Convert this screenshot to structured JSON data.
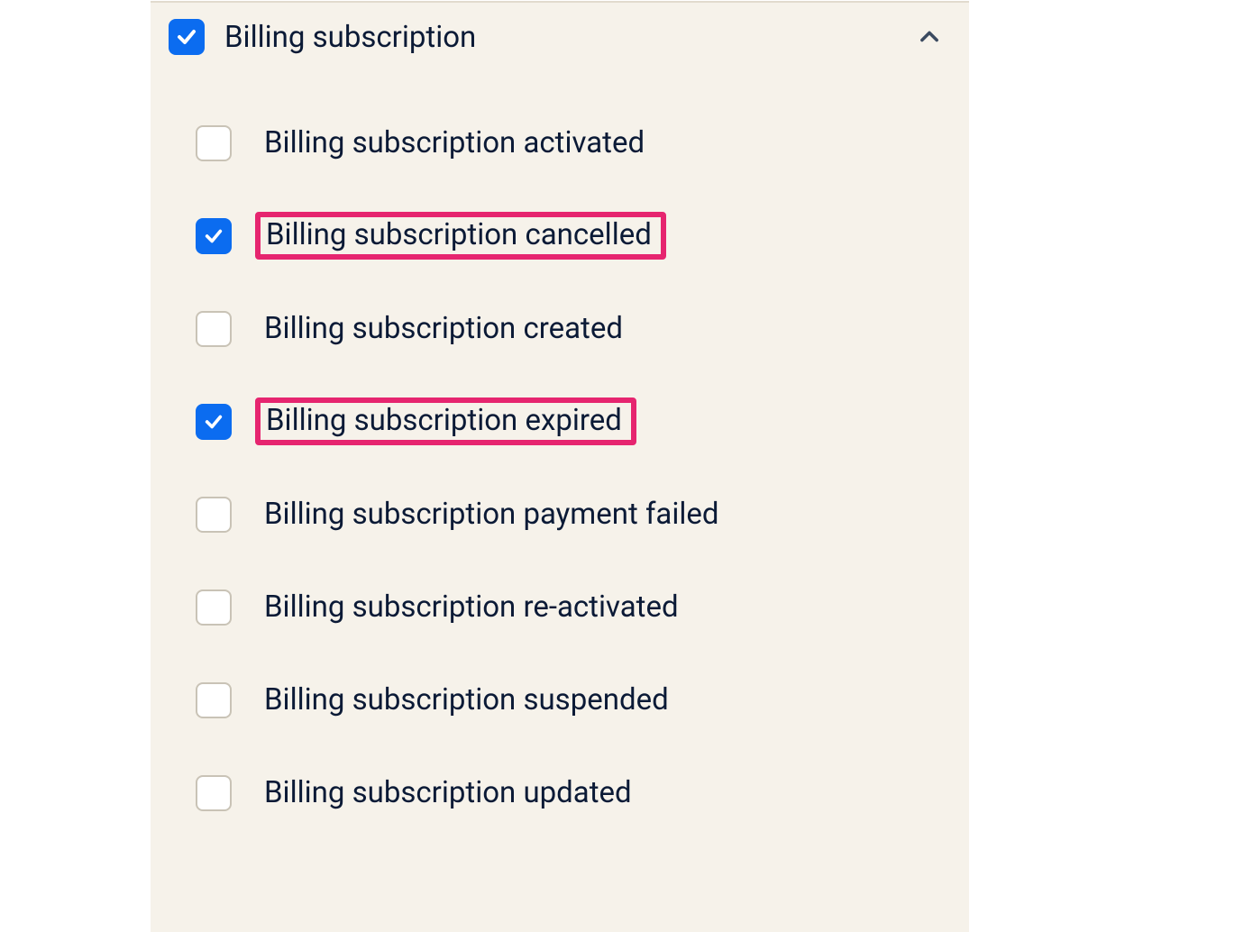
{
  "parent": {
    "label": "Billing subscription",
    "checked": true,
    "expanded": true
  },
  "children": [
    {
      "label": "Billing subscription activated",
      "checked": false,
      "highlighted": false
    },
    {
      "label": "Billing subscription cancelled",
      "checked": true,
      "highlighted": true
    },
    {
      "label": "Billing subscription created",
      "checked": false,
      "highlighted": false
    },
    {
      "label": "Billing subscription expired",
      "checked": true,
      "highlighted": true
    },
    {
      "label": "Billing subscription payment failed",
      "checked": false,
      "highlighted": false
    },
    {
      "label": "Billing subscription re-activated",
      "checked": false,
      "highlighted": false
    },
    {
      "label": "Billing subscription suspended",
      "checked": false,
      "highlighted": false
    },
    {
      "label": "Billing subscription updated",
      "checked": false,
      "highlighted": false
    }
  ],
  "colors": {
    "checkbox_checked": "#0b6cf0",
    "highlight_border": "#e6256f",
    "panel_bg": "#f6f2ea",
    "text": "#0b1a36"
  }
}
